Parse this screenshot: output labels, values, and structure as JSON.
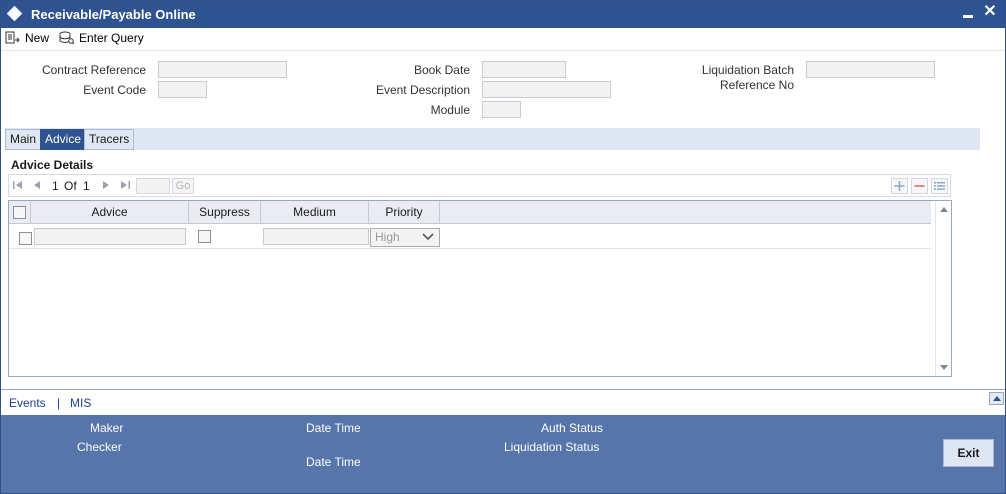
{
  "window": {
    "title": "Receivable/Payable Online"
  },
  "toolbar": {
    "new_label": "New",
    "enter_query_label": "Enter Query"
  },
  "header_fields": {
    "contract_reference": {
      "label": "Contract Reference",
      "value": ""
    },
    "event_code": {
      "label": "Event Code",
      "value": ""
    },
    "book_date": {
      "label": "Book Date",
      "value": ""
    },
    "event_description": {
      "label": "Event Description",
      "value": ""
    },
    "module": {
      "label": "Module",
      "value": ""
    },
    "liquidation_batch": {
      "label_line1": "Liquidation Batch",
      "label_line2": "Reference No",
      "value": ""
    }
  },
  "tabs": [
    {
      "label": "Main",
      "active": false
    },
    {
      "label": "Advice",
      "active": true
    },
    {
      "label": "Tracers",
      "active": false
    }
  ],
  "advice_section": {
    "title": "Advice Details",
    "pagination": {
      "current": "1",
      "of_label": "Of",
      "total": "1",
      "go_label": "Go"
    },
    "columns": [
      "Advice",
      "Suppress",
      "Medium",
      "Priority"
    ],
    "rows": [
      {
        "advice": "",
        "suppress": false,
        "medium": "",
        "priority": "High"
      }
    ]
  },
  "bottom_links": {
    "events": "Events",
    "separator": "|",
    "mis": "MIS"
  },
  "footer": {
    "maker_label": "Maker",
    "checker_label": "Checker",
    "date_time_label_1": "Date Time",
    "date_time_label_2": "Date Time",
    "auth_status_label": "Auth Status",
    "liquidation_status_label": "Liquidation Status",
    "exit_label": "Exit"
  },
  "colors": {
    "title_bar": "#2f5290",
    "footer": "#5575ab",
    "active_tab": "#2f5290",
    "link": "#1d3f8a"
  }
}
